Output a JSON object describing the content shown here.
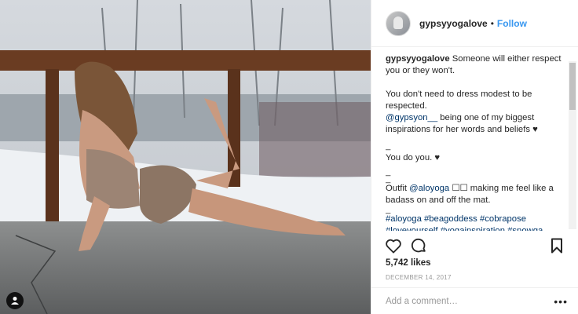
{
  "post": {
    "username": "gypsyyogalove",
    "follow_label": "Follow",
    "separator": "•",
    "caption": {
      "user": "gypsyyogalove",
      "line1": "Someone will either respect you or they won't.",
      "line2": "You don't need to dress modest to be respected.",
      "mention": "@gypsyon__",
      "line3": " being one of my biggest inspirations for her words and beliefs ♥",
      "dash1": "_",
      "line4": "You do you. ♥",
      "dash2": "_",
      "dash3": "_",
      "outfit_prefix": "Outfit ",
      "outfit_mention": "@aloyoga",
      "outfit_rest": " ☐☐ making me feel like a badass on and off the mat.",
      "dash4": "_",
      "hashtags": "#aloyoga #beagoddess #cobrapose #loveyourself #yogainspiration #snowga"
    },
    "likes": "5,742 likes",
    "date": "December 14, 2017",
    "add_comment_placeholder": "Add a comment…",
    "more_label": "•••"
  },
  "icons": {
    "like": "heart-icon",
    "comment": "comment-icon",
    "save": "bookmark-icon",
    "tag": "user-tag-icon"
  },
  "colors": {
    "link": "#003569",
    "follow": "#3897f0",
    "muted": "#999999"
  }
}
